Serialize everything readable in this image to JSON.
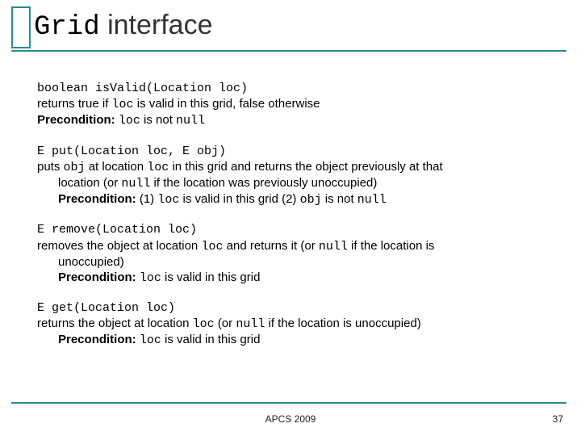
{
  "title": {
    "code": "Grid",
    "rest": " interface"
  },
  "methods": [
    {
      "sig": "boolean isValid(Location loc)",
      "line1_pre": "returns true if ",
      "line1_code": "loc",
      "line1_post": " is valid in this grid, false otherwise",
      "pre_label": "Precondition: ",
      "pre_code": "loc",
      "pre_mid": " is not ",
      "pre_code2": "null"
    },
    {
      "sig": "E put(Location loc, E obj)",
      "line1_pre": "puts ",
      "line1_code": "obj",
      "line1_mid": " at location ",
      "line1_code2": "loc",
      "line1_post": " in this grid and returns the object previously at that",
      "line2_pre": "location (or ",
      "line2_code": "null",
      "line2_post": " if the location was previously unoccupied)",
      "pre_label": "Precondition: ",
      "pre_text1": "(1) ",
      "pre_code": "loc",
      "pre_mid": " is valid in this grid (2) ",
      "pre_code2": "obj",
      "pre_mid2": " is not ",
      "pre_code3": "null"
    },
    {
      "sig": "E remove(Location loc)",
      "line1_pre": "removes the object at location ",
      "line1_code": "loc",
      "line1_post": " and returns it (or ",
      "line1_code2": "null",
      "line1_post2": " if the location is",
      "line2": "unoccupied)",
      "pre_label": "Precondition: ",
      "pre_code": "loc",
      "pre_post": " is valid in this grid"
    },
    {
      "sig": "E get(Location loc)",
      "line1_pre": "returns the object at location ",
      "line1_code": "loc",
      "line1_post": " (or ",
      "line1_code2": "null",
      "line1_post2": " if the location is unoccupied)",
      "pre_label": "Precondition: ",
      "pre_code": "loc",
      "pre_post": " is valid in this grid"
    }
  ],
  "footer": "APCS 2009",
  "page": "37"
}
